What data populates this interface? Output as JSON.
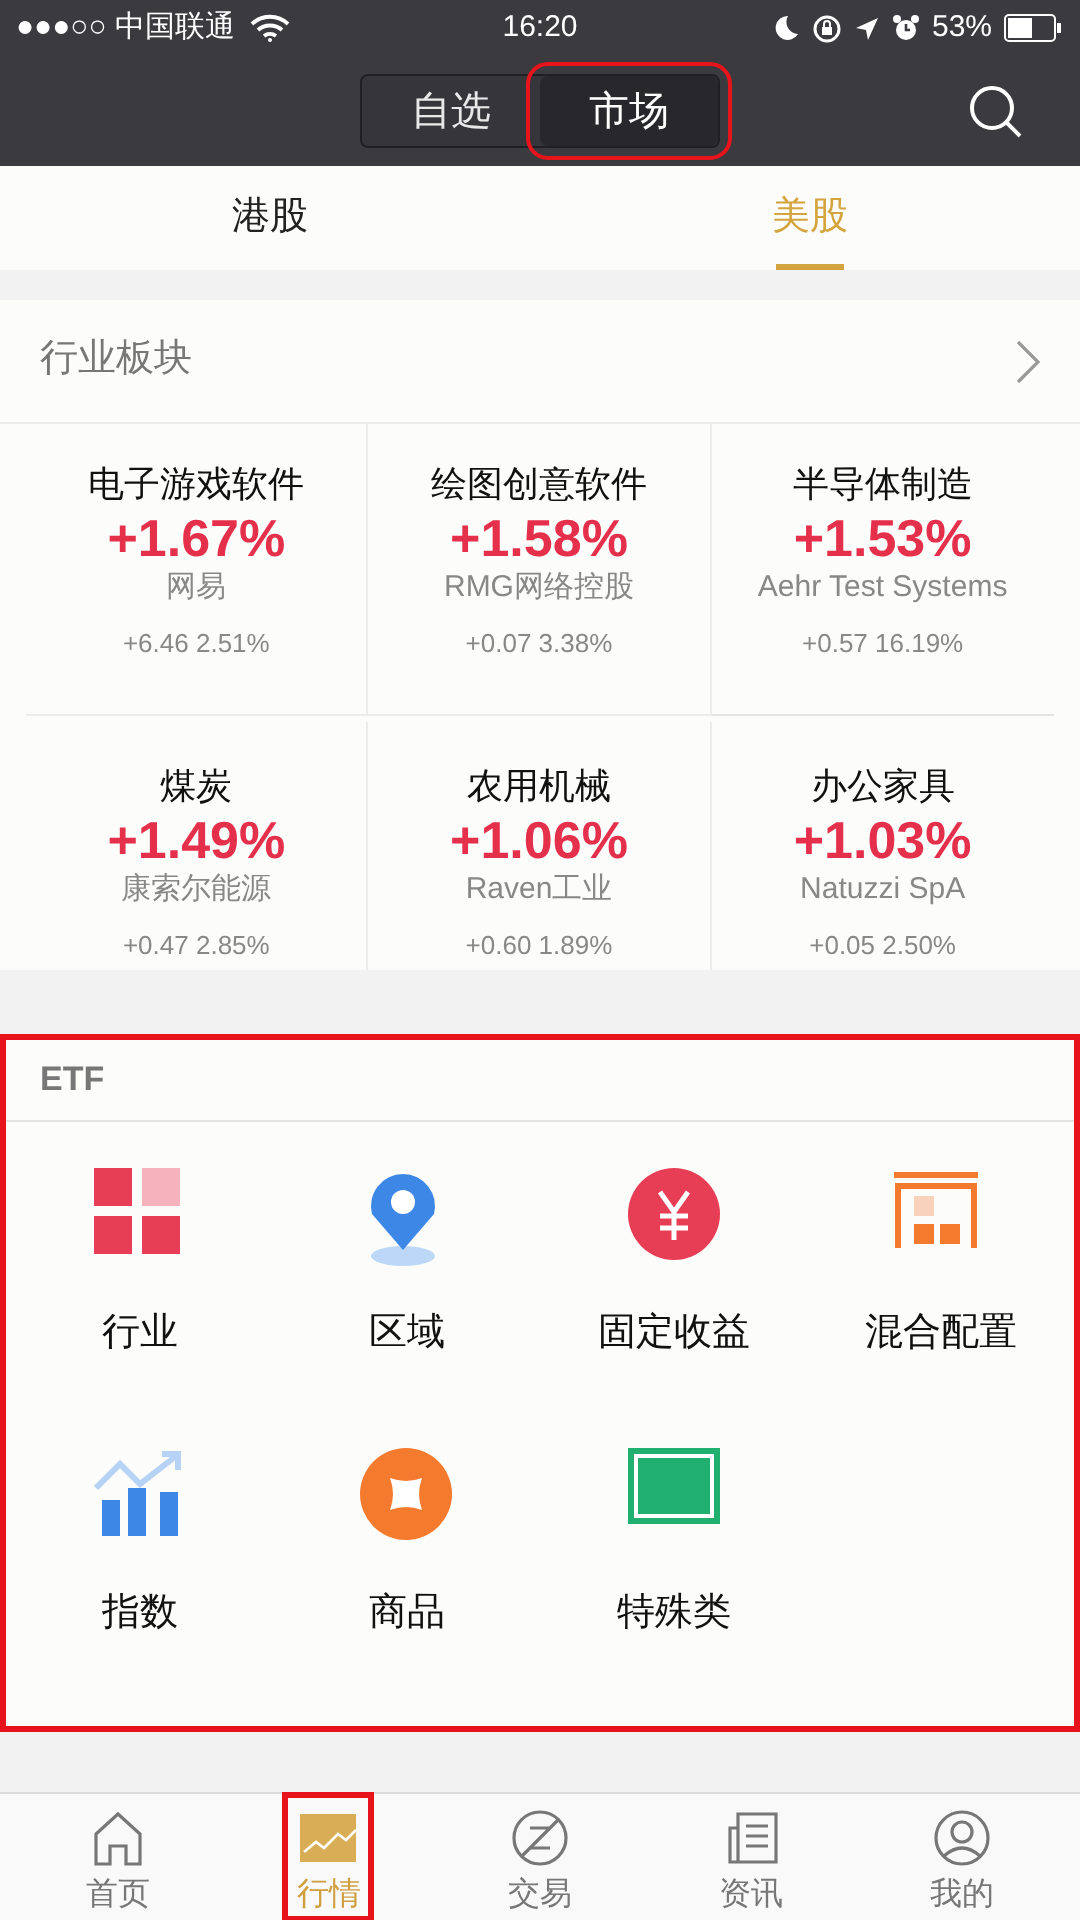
{
  "status_bar": {
    "carrier": "●●●○○ 中国联通",
    "time": "16:20",
    "battery": "53%"
  },
  "top_tabs": [
    {
      "label": "自选",
      "selected": false,
      "highlighted": false
    },
    {
      "label": "市场",
      "selected": true,
      "highlighted": true
    }
  ],
  "market_tabs": [
    {
      "label": "港股",
      "selected": false
    },
    {
      "label": "美股",
      "selected": true
    }
  ],
  "sectors": {
    "title": "行业板块",
    "items": [
      {
        "name": "电子游戏软件",
        "change": "+1.67%",
        "stock": "网易",
        "stock_change": "+6.46 2.51%"
      },
      {
        "name": "绘图创意软件",
        "change": "+1.58%",
        "stock": "RMG网络控股",
        "stock_change": "+0.07 3.38%"
      },
      {
        "name": "半导体制造",
        "change": "+1.53%",
        "stock": "Aehr Test Systems",
        "stock_change": "+0.57 16.19%"
      },
      {
        "name": "煤炭",
        "change": "+1.49%",
        "stock": "康索尔能源",
        "stock_change": "+0.47 2.85%"
      },
      {
        "name": "农用机械",
        "change": "+1.06%",
        "stock": "Raven工业",
        "stock_change": "+0.60 1.89%"
      },
      {
        "name": "办公家具",
        "change": "+1.03%",
        "stock": "Natuzzi SpA",
        "stock_change": "+0.05 2.50%"
      }
    ]
  },
  "etf": {
    "title": "ETF",
    "highlighted": true,
    "items": [
      {
        "label": "行业",
        "kind": "grid"
      },
      {
        "label": "区域",
        "kind": "pin"
      },
      {
        "label": "固定收益",
        "kind": "yen"
      },
      {
        "label": "混合配置",
        "kind": "mixed"
      },
      {
        "label": "指数",
        "kind": "index"
      },
      {
        "label": "商品",
        "kind": "commodity"
      },
      {
        "label": "特殊类",
        "kind": "special"
      }
    ]
  },
  "bottom_nav": [
    {
      "label": "首页",
      "kind": "home",
      "selected": false,
      "highlighted": false
    },
    {
      "label": "行情",
      "kind": "market",
      "selected": true,
      "highlighted": true
    },
    {
      "label": "交易",
      "kind": "trade",
      "selected": false,
      "highlighted": false
    },
    {
      "label": "资讯",
      "kind": "news",
      "selected": false,
      "highlighted": false
    },
    {
      "label": "我的",
      "kind": "me",
      "selected": false,
      "highlighted": false
    }
  ]
}
